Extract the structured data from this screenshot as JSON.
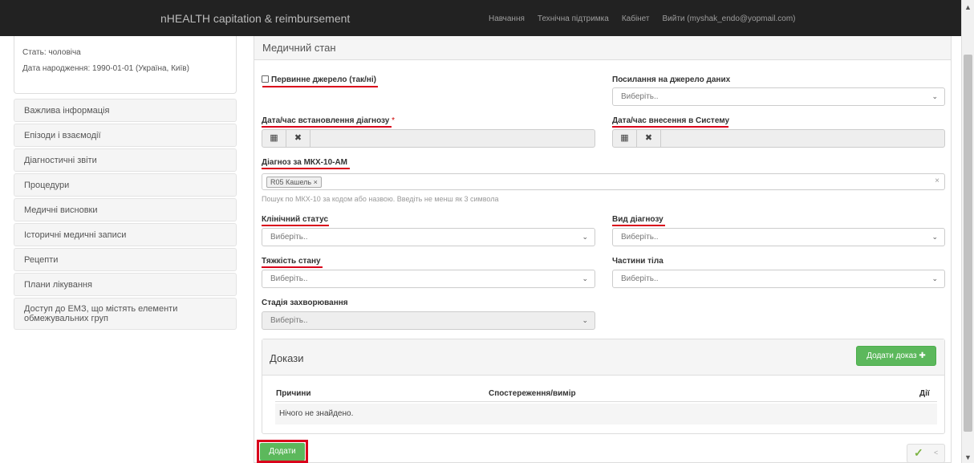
{
  "navbar": {
    "brand": "nHEALTH capitation & reimbursement",
    "links": [
      "Навчання",
      "Технічна підтримка",
      "Кабінет",
      "Вийти (myshak_endo@yopmail.com)"
    ]
  },
  "patient": {
    "gender": "Стать: чоловіча",
    "birth": "Дата народження: 1990-01-01 (Україна, Київ)"
  },
  "sidebar": {
    "items": [
      "Важлива інформація",
      "Епізоди і взаємодії",
      "Діагностичні звіти",
      "Процедури",
      "Медичні висновки",
      "Історичні медичні записи",
      "Рецепти",
      "Плани лікування",
      "Доступ до ЕМЗ, що містять елементи обмежувальних груп"
    ]
  },
  "form": {
    "heading": "Медичний стан",
    "primary_source_label": "Первинне джерело (так/ні)",
    "source_ref_label": "Посилання на джерело даних",
    "placeholder": "Виберіть..",
    "diag_datetime_label": "Дата/час встановлення діагнозу",
    "required_mark": "*",
    "entry_datetime_label": "Дата/час внесення в Систему",
    "icd_label": "Діагноз за МКХ-10-АМ",
    "icd_tag": "R05 Кашель ×",
    "icd_clear": "×",
    "icd_help": "Пошук по МКХ-10 за кодом або назвою. Введіть не менш як 3 символа",
    "clinical_status_label": "Клінічний статус",
    "diag_type_label": "Вид діагнозу",
    "severity_label": "Тяжкість стану",
    "body_parts_label": "Частини тіла",
    "stage_label": "Стадія захворювання"
  },
  "evidence": {
    "title": "Докази",
    "add_label": "Додати доказ ✚",
    "columns": [
      "Причини",
      "Спостереження/вимір",
      "Дії"
    ],
    "empty": "Нічого не знайдено."
  },
  "submit_label": "Додати",
  "icons": {
    "calendar": "calendar-icon",
    "clear": "times-icon",
    "chevron": "chevron-down-icon"
  }
}
